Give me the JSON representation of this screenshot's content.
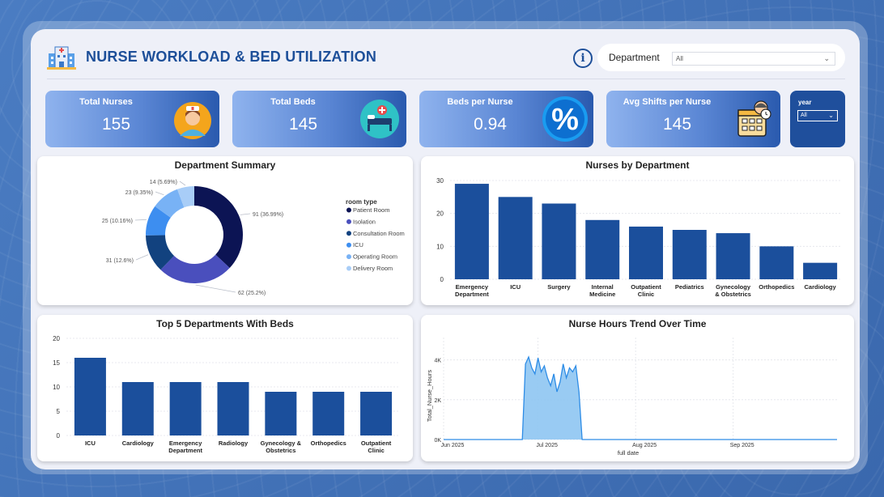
{
  "header": {
    "title": "NURSE WORKLOAD & BED UTILIZATION",
    "info_icon": "i",
    "department_label": "Department",
    "department_value": "All"
  },
  "kpis": [
    {
      "label": "Total Nurses",
      "value": "155",
      "icon": "nurse-icon"
    },
    {
      "label": "Total Beds",
      "value": "145",
      "icon": "hospital-bed-icon"
    },
    {
      "label": "Beds per Nurse",
      "value": "0.94",
      "icon": "percent-icon"
    },
    {
      "label": "Avg Shifts per Nurse",
      "value": "145",
      "icon": "schedule-icon"
    }
  ],
  "year_filter": {
    "label": "year",
    "value": "All"
  },
  "colors": {
    "accent": "#1d4f99",
    "bar": "#1b4f9c",
    "area": "#8ec5f2",
    "line": "#2d8ce6",
    "donut": [
      "#0c1454",
      "#4a4fbd",
      "#12427f",
      "#3d8ef0",
      "#78b2f5",
      "#a8cdf7"
    ]
  },
  "chart_data": [
    {
      "type": "pie",
      "title": "Department Summary",
      "legend_title": "room type",
      "legend_position": "right",
      "categories": [
        "Patient Room",
        "Isolation",
        "Consultation Room",
        "ICU",
        "Operating Room",
        "Delivery Room"
      ],
      "values": [
        91,
        62,
        31,
        25,
        23,
        14
      ],
      "labels": [
        "91 (36.99%)",
        "62 (25.2%)",
        "31 (12.6%)",
        "25 (10.16%)",
        "23 (9.35%)",
        "14 (5.69%)"
      ]
    },
    {
      "type": "bar",
      "title": "Nurses by Department",
      "categories": [
        "Emergency Department",
        "ICU",
        "Surgery",
        "Internal Medicine",
        "Outpatient Clinic",
        "Pediatrics",
        "Gynecology & Obstetrics",
        "Orthopedics",
        "Cardiology"
      ],
      "category_lines": [
        [
          "Emergency",
          "Department"
        ],
        [
          "ICU"
        ],
        [
          "Surgery"
        ],
        [
          "Internal",
          "Medicine"
        ],
        [
          "Outpatient",
          "Clinic"
        ],
        [
          "Pediatrics"
        ],
        [
          "Gynecology",
          "& Obstetrics"
        ],
        [
          "Orthopedics"
        ],
        [
          "Cardiology"
        ]
      ],
      "values": [
        29,
        25,
        23,
        18,
        16,
        15,
        14,
        10,
        5
      ],
      "ylim": [
        0,
        30
      ],
      "yticks": [
        "0",
        "10",
        "20",
        "30"
      ],
      "grid": true
    },
    {
      "type": "bar",
      "title": "Top 5 Departments With Beds",
      "categories": [
        "ICU",
        "Cardiology",
        "Emergency Department",
        "Radiology",
        "Gynecology & Obstetrics",
        "Orthopedics",
        "Outpatient Clinic"
      ],
      "category_lines": [
        [
          "ICU"
        ],
        [
          "Cardiology"
        ],
        [
          "Emergency",
          "Department"
        ],
        [
          "Radiology"
        ],
        [
          "Gynecology &",
          "Obstetrics"
        ],
        [
          "Orthopedics"
        ],
        [
          "Outpatient",
          "Clinic"
        ]
      ],
      "values": [
        16,
        11,
        11,
        11,
        9,
        9,
        9
      ],
      "ylim": [
        0,
        20
      ],
      "yticks": [
        "0",
        "5",
        "10",
        "15",
        "20"
      ],
      "grid": true
    },
    {
      "type": "area",
      "title": "Nurse Hours Trend Over Time",
      "xlabel": "full date",
      "ylabel": "Total_Nurse_Hours",
      "xticks": [
        "Jun 2025",
        "Jul 2025",
        "Aug 2025",
        "Sep 2025"
      ],
      "yticks": [
        "0K",
        "2K",
        "4K"
      ],
      "ylim": [
        0,
        4800
      ],
      "x_range": [
        "2025-06-01",
        "2025-10-04"
      ],
      "series": [
        {
          "x": [
            "2025-06-01",
            "2025-06-26",
            "2025-06-27",
            "2025-06-28",
            "2025-06-29",
            "2025-06-30",
            "2025-07-01",
            "2025-07-02",
            "2025-07-03",
            "2025-07-04",
            "2025-07-05",
            "2025-07-06",
            "2025-07-07",
            "2025-07-08",
            "2025-07-09",
            "2025-07-10",
            "2025-07-11",
            "2025-07-12",
            "2025-07-13",
            "2025-07-14",
            "2025-07-15",
            "2025-07-16",
            "2025-07-17",
            "2025-07-18",
            "2025-10-04"
          ],
          "y": [
            0,
            0,
            3800,
            4150,
            3600,
            3300,
            4100,
            3400,
            3700,
            3100,
            2700,
            3300,
            2400,
            2900,
            3800,
            3100,
            3600,
            3400,
            3700,
            2400,
            0,
            0,
            0,
            0,
            0
          ]
        }
      ]
    }
  ]
}
